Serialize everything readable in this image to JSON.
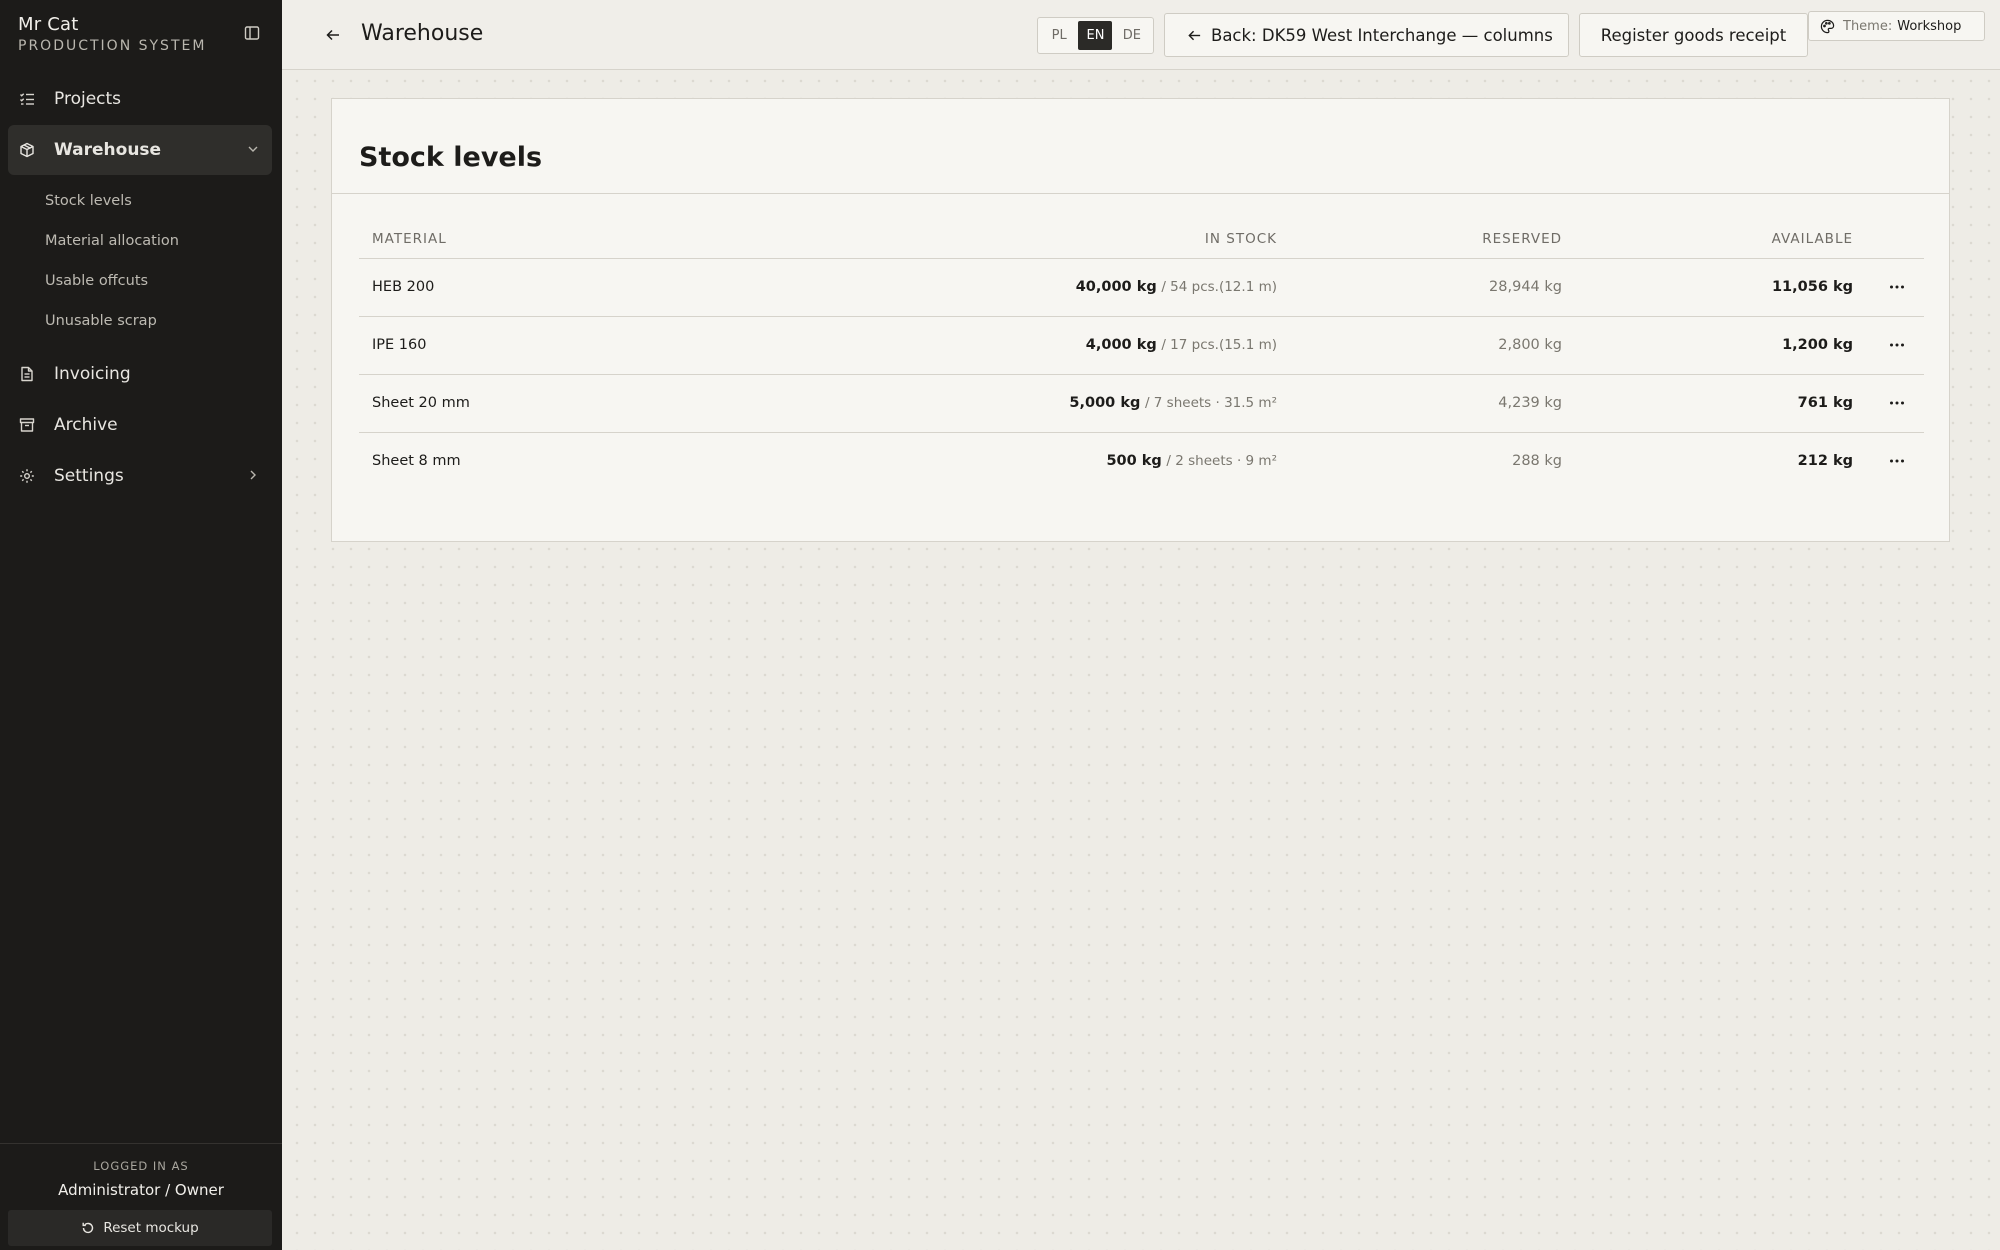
{
  "brand": {
    "name": "Mr Cat",
    "subtitle": "PRODUCTION SYSTEM"
  },
  "sidebar": {
    "items": [
      {
        "label": "Projects",
        "icon": "list-check-icon"
      },
      {
        "label": "Warehouse",
        "icon": "package-icon",
        "active": true,
        "children": [
          "Stock levels",
          "Material allocation",
          "Usable offcuts",
          "Unusable scrap"
        ]
      },
      {
        "label": "Invoicing",
        "icon": "document-icon"
      },
      {
        "label": "Archive",
        "icon": "archive-icon"
      },
      {
        "label": "Settings",
        "icon": "gear-icon"
      }
    ],
    "footer": {
      "logged_label": "LOGGED IN AS",
      "user": "Administrator / Owner",
      "reset_label": "Reset mockup"
    }
  },
  "header": {
    "title": "Warehouse",
    "languages": [
      "PL",
      "EN",
      "DE"
    ],
    "active_language": "EN",
    "back_button": "Back: DK59 West Interchange — columns",
    "receipt_button": "Register goods receipt",
    "theme_label": "Theme:",
    "theme_value": "Workshop"
  },
  "card": {
    "title": "Stock levels",
    "columns": [
      "MATERIAL",
      "IN STOCK",
      "RESERVED",
      "AVAILABLE"
    ],
    "rows": [
      {
        "material": "HEB 200",
        "stock": "40,000 kg",
        "stock_detail": "/ 54 pcs.(12.1 m)",
        "reserved": "28,944 kg",
        "available": "11,056 kg"
      },
      {
        "material": "IPE 160",
        "stock": "4,000 kg",
        "stock_detail": "/ 17 pcs.(15.1 m)",
        "reserved": "2,800 kg",
        "available": "1,200 kg"
      },
      {
        "material": "Sheet 20 mm",
        "stock": "5,000 kg",
        "stock_detail": "/ 7 sheets · 31.5 m²",
        "reserved": "4,239 kg",
        "available": "761 kg"
      },
      {
        "material": "Sheet 8 mm",
        "stock": "500 kg",
        "stock_detail": "/ 2 sheets · 9 m²",
        "reserved": "288 kg",
        "available": "212 kg"
      }
    ]
  },
  "colors": {
    "sidebar_bg": "#1c1b19",
    "active_lang_bg": "#2b2a27",
    "page_bg": "#eeece6"
  }
}
